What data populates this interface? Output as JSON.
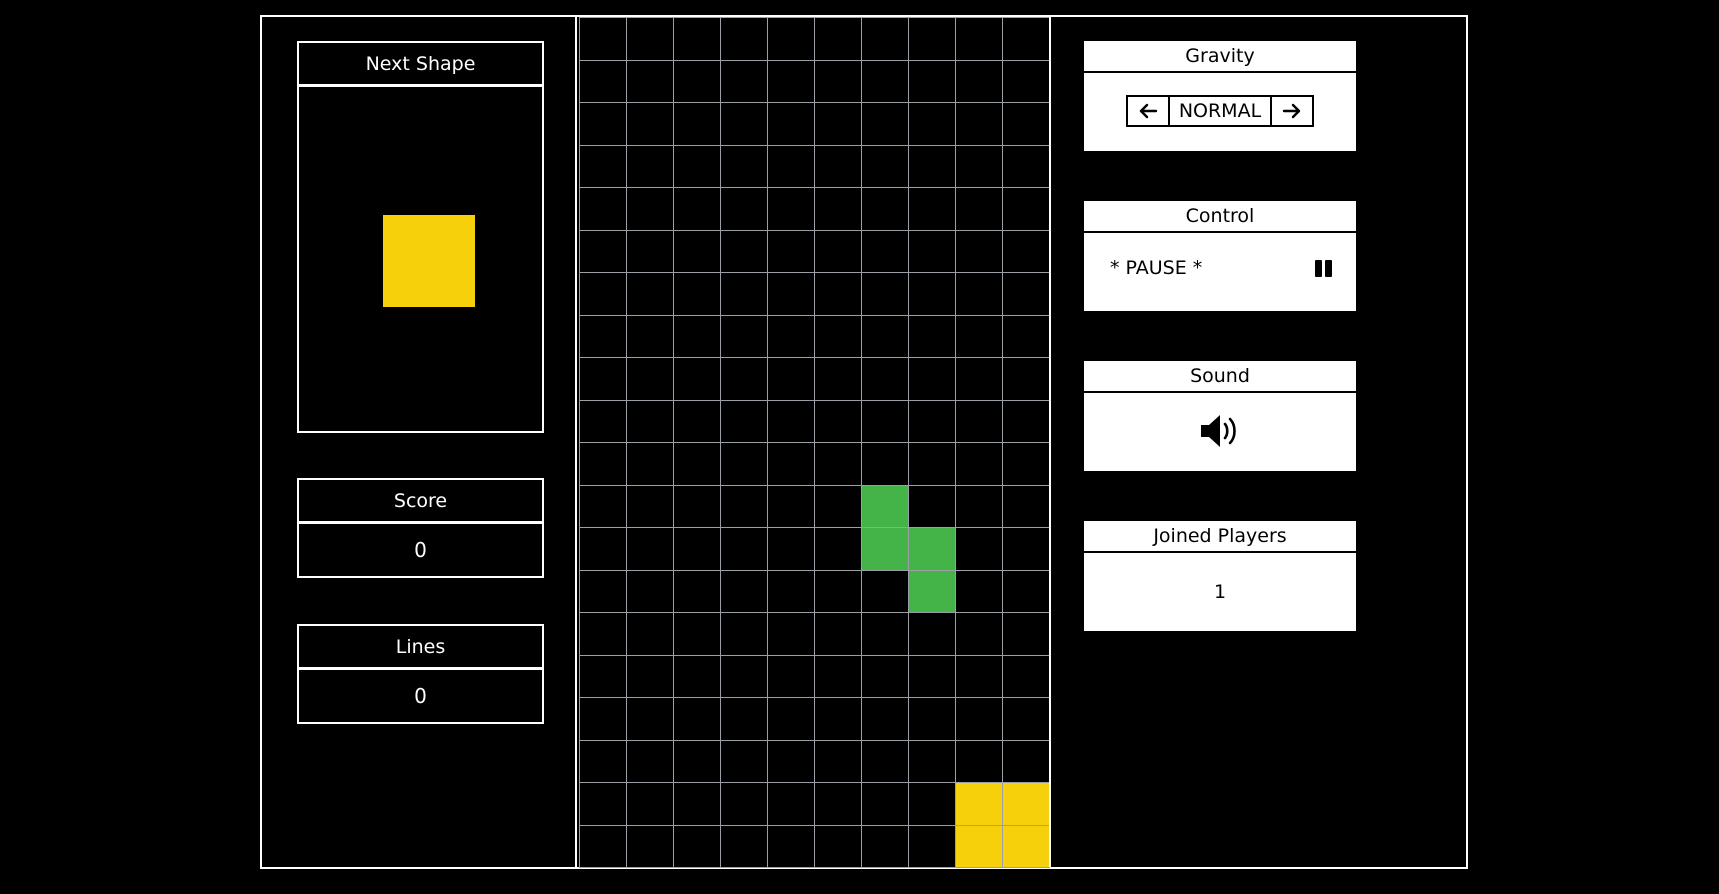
{
  "left_panel": {
    "next_shape": {
      "title": "Next Shape",
      "shape": "O",
      "color": "#f6d10b"
    },
    "score": {
      "title": "Score",
      "value": "0"
    },
    "lines": {
      "title": "Lines",
      "value": "0"
    }
  },
  "board": {
    "columns": 10,
    "rows": 20,
    "empty_color": "#000000",
    "grid_color": "#9aa0a6",
    "filled_cells": [
      {
        "row": 11,
        "col": 6,
        "color": "#44b348"
      },
      {
        "row": 12,
        "col": 6,
        "color": "#44b348"
      },
      {
        "row": 12,
        "col": 7,
        "color": "#44b348"
      },
      {
        "row": 13,
        "col": 7,
        "color": "#44b348"
      },
      {
        "row": 18,
        "col": 8,
        "color": "#f6d10b"
      },
      {
        "row": 18,
        "col": 9,
        "color": "#f6d10b"
      },
      {
        "row": 19,
        "col": 8,
        "color": "#f6d10b"
      },
      {
        "row": 19,
        "col": 9,
        "color": "#f6d10b"
      }
    ]
  },
  "right_panel": {
    "gravity": {
      "title": "Gravity",
      "value": "NORMAL",
      "prev_icon": "arrow-left-icon",
      "next_icon": "arrow-right-icon"
    },
    "control": {
      "title": "Control",
      "status": "* PAUSE *",
      "icon": "pause-icon"
    },
    "sound": {
      "title": "Sound",
      "icon": "speaker-on-icon"
    },
    "joined_players": {
      "title": "Joined Players",
      "value": "1"
    }
  }
}
